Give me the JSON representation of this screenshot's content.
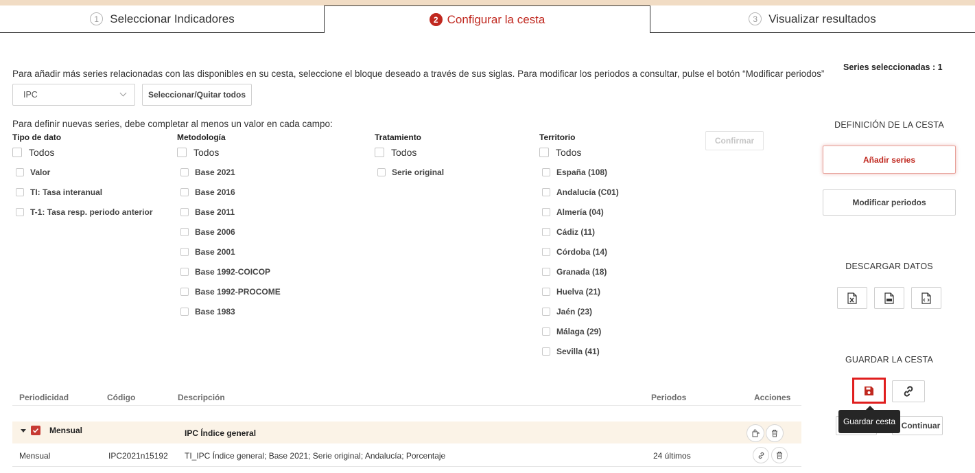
{
  "tabs": [
    {
      "num": "1",
      "label": "Seleccionar Indicadores"
    },
    {
      "num": "2",
      "label": "Configurar la cesta"
    },
    {
      "num": "3",
      "label": "Visualizar resultados"
    }
  ],
  "intro_text": "Para añadir más series relacionadas con las disponibles en su cesta, seleccione el bloque deseado a través de sus siglas. Para modificar los periodos a consultar, pulse el botón “Modificar periodos”",
  "block_select": {
    "value": "IPC"
  },
  "toggle_all_label": "Seleccionar/Quitar todos",
  "define_text": "Para definir nuevas series, debe completar al menos un valor en cada campo:",
  "all_label": "Todos",
  "filters": {
    "tipo": {
      "title": "Tipo de dato",
      "options": [
        "Valor",
        "TI: Tasa interanual",
        "T-1: Tasa resp. periodo anterior"
      ]
    },
    "metodologia": {
      "title": "Metodología",
      "options": [
        "Base 2021",
        "Base 2016",
        "Base 2011",
        "Base 2006",
        "Base 2001",
        "Base 1992-COICOP",
        "Base 1992-PROCOME",
        "Base 1983"
      ]
    },
    "tratamiento": {
      "title": "Tratamiento",
      "options": [
        "Serie original"
      ]
    },
    "territorio": {
      "title": "Territorio",
      "options": [
        "España (108)",
        "Andalucía (C01)",
        "Almería (04)",
        "Cádiz (11)",
        "Córdoba (14)",
        "Granada (18)",
        "Huelva (21)",
        "Jaén (23)",
        "Málaga (29)",
        "Sevilla (41)"
      ]
    }
  },
  "confirm_label": "Confirmar",
  "sidebar": {
    "series_count": "Series seleccionadas : 1",
    "cesta_title": "DEFINICIÓN DE LA CESTA",
    "add_label": "Añadir series",
    "modify_label": "Modificar periodos",
    "download_title": "DESCARGAR DATOS",
    "download_icons": [
      "excel-file-icon",
      "csv-file-icon",
      "code-file-icon"
    ],
    "save_title": "GUARDAR LA CESTA",
    "save_tooltip": "Guardar cesta",
    "continue_label": "Continuar"
  },
  "table": {
    "headers": {
      "periodicidad": "Periodicidad",
      "codigo": "Código",
      "descripcion": "Descripción",
      "periodos": "Periodos",
      "acciones": "Acciones"
    },
    "group": {
      "label": "Mensual",
      "description": "IPC Índice general",
      "checked": true
    },
    "rows": [
      {
        "periodicidad": "Mensual",
        "codigo": "IPC2021n15192",
        "descripcion": "TI_IPC Índice general; Base 2021; Serie original; Andalucía; Porcentaje",
        "periodos": "24 últimos"
      }
    ]
  },
  "colors": {
    "accent": "#c0281f",
    "highlight_border": "#e01e1e",
    "band": "#f1dcc4",
    "group_row": "#fbf3e7"
  }
}
